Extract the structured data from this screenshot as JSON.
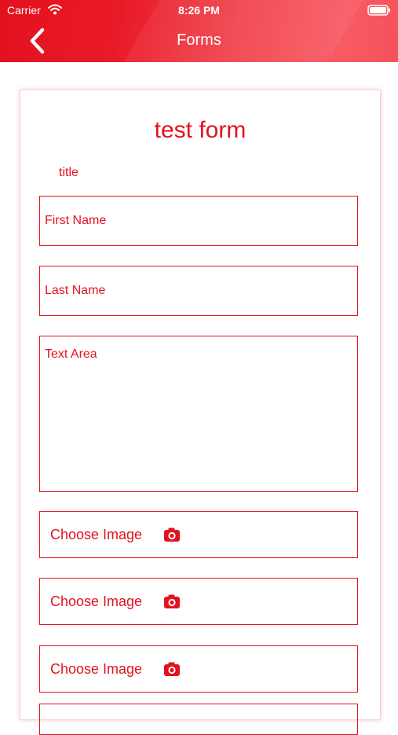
{
  "status_bar": {
    "carrier": "Carrier",
    "time": "8:26 PM"
  },
  "nav": {
    "title": "Forms",
    "back_icon": "chevron-left-icon"
  },
  "form": {
    "title": "test form",
    "subtitle": "title",
    "fields": {
      "first_name": "First Name",
      "last_name": "Last Name",
      "text_area": "Text Area"
    },
    "image_pickers": [
      {
        "label": "Choose Image",
        "icon": "camera-icon"
      },
      {
        "label": "Choose Image",
        "icon": "camera-icon"
      },
      {
        "label": "Choose Image",
        "icon": "camera-icon"
      }
    ]
  },
  "colors": {
    "accent": "#e3121f",
    "header_start": "#e4111f",
    "header_end": "#f85a63"
  }
}
